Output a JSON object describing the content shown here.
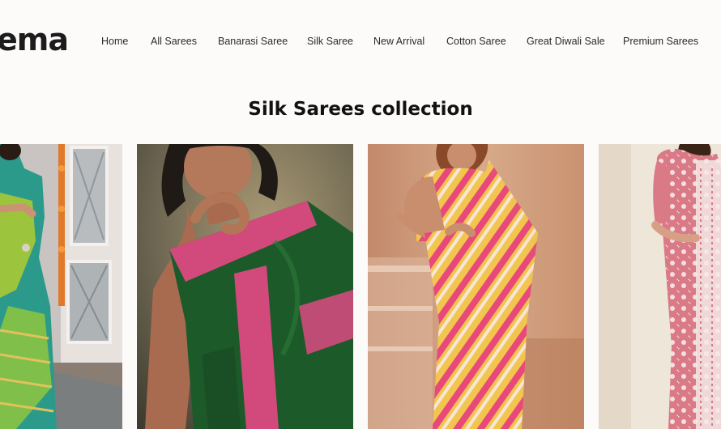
{
  "brand": {
    "logo_text": "ema"
  },
  "nav": {
    "items": [
      {
        "label": "Home"
      },
      {
        "label": "All Sarees"
      },
      {
        "label": "Banarasi Saree"
      },
      {
        "label": "Silk Saree"
      },
      {
        "label": "New Arrival"
      },
      {
        "label": "Cotton Saree"
      },
      {
        "label": "Great Diwali Sale"
      },
      {
        "label": "Premium Sarees"
      }
    ]
  },
  "collection": {
    "title": "Silk Sarees collection",
    "products": [
      {
        "image": "green-teal-silk-saree-photo"
      },
      {
        "image": "green-pink-border-silk-saree-photo"
      },
      {
        "image": "pink-yellow-striped-silk-saree-photo"
      },
      {
        "image": "pink-white-embroidered-silk-saree-photo"
      }
    ]
  }
}
